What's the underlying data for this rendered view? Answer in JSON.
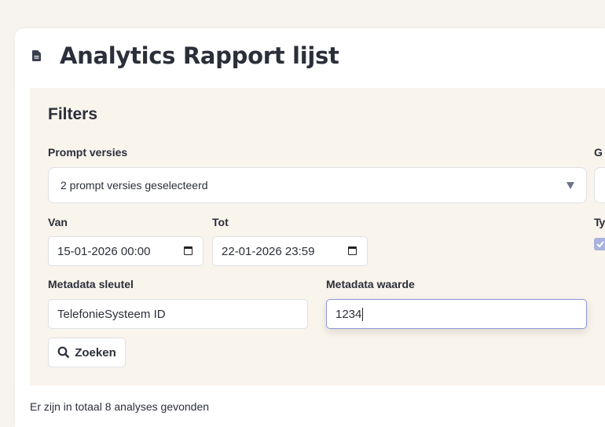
{
  "header": {
    "title": "Analytics Rapport lijst",
    "icon": "document-icon"
  },
  "filters": {
    "heading": "Filters",
    "prompt_versions": {
      "label": "Prompt versies",
      "value": "2 prompt versies geselecteerd"
    },
    "clipped_label_1": "G",
    "clipped_label_2": "Ty",
    "type_checkbox_checked": true,
    "from": {
      "label": "Van",
      "value": "15-01-2026 00:00"
    },
    "to": {
      "label": "Tot",
      "value": "22-01-2026 23:59"
    },
    "metadata_key": {
      "label": "Metadata sleutel",
      "value": "TelefonieSysteem ID"
    },
    "metadata_value": {
      "label": "Metadata waarde",
      "value": "1234"
    },
    "search_button": "Zoeken"
  },
  "results": {
    "summary": "Er zijn in totaal 8 analyses gevonden"
  }
}
